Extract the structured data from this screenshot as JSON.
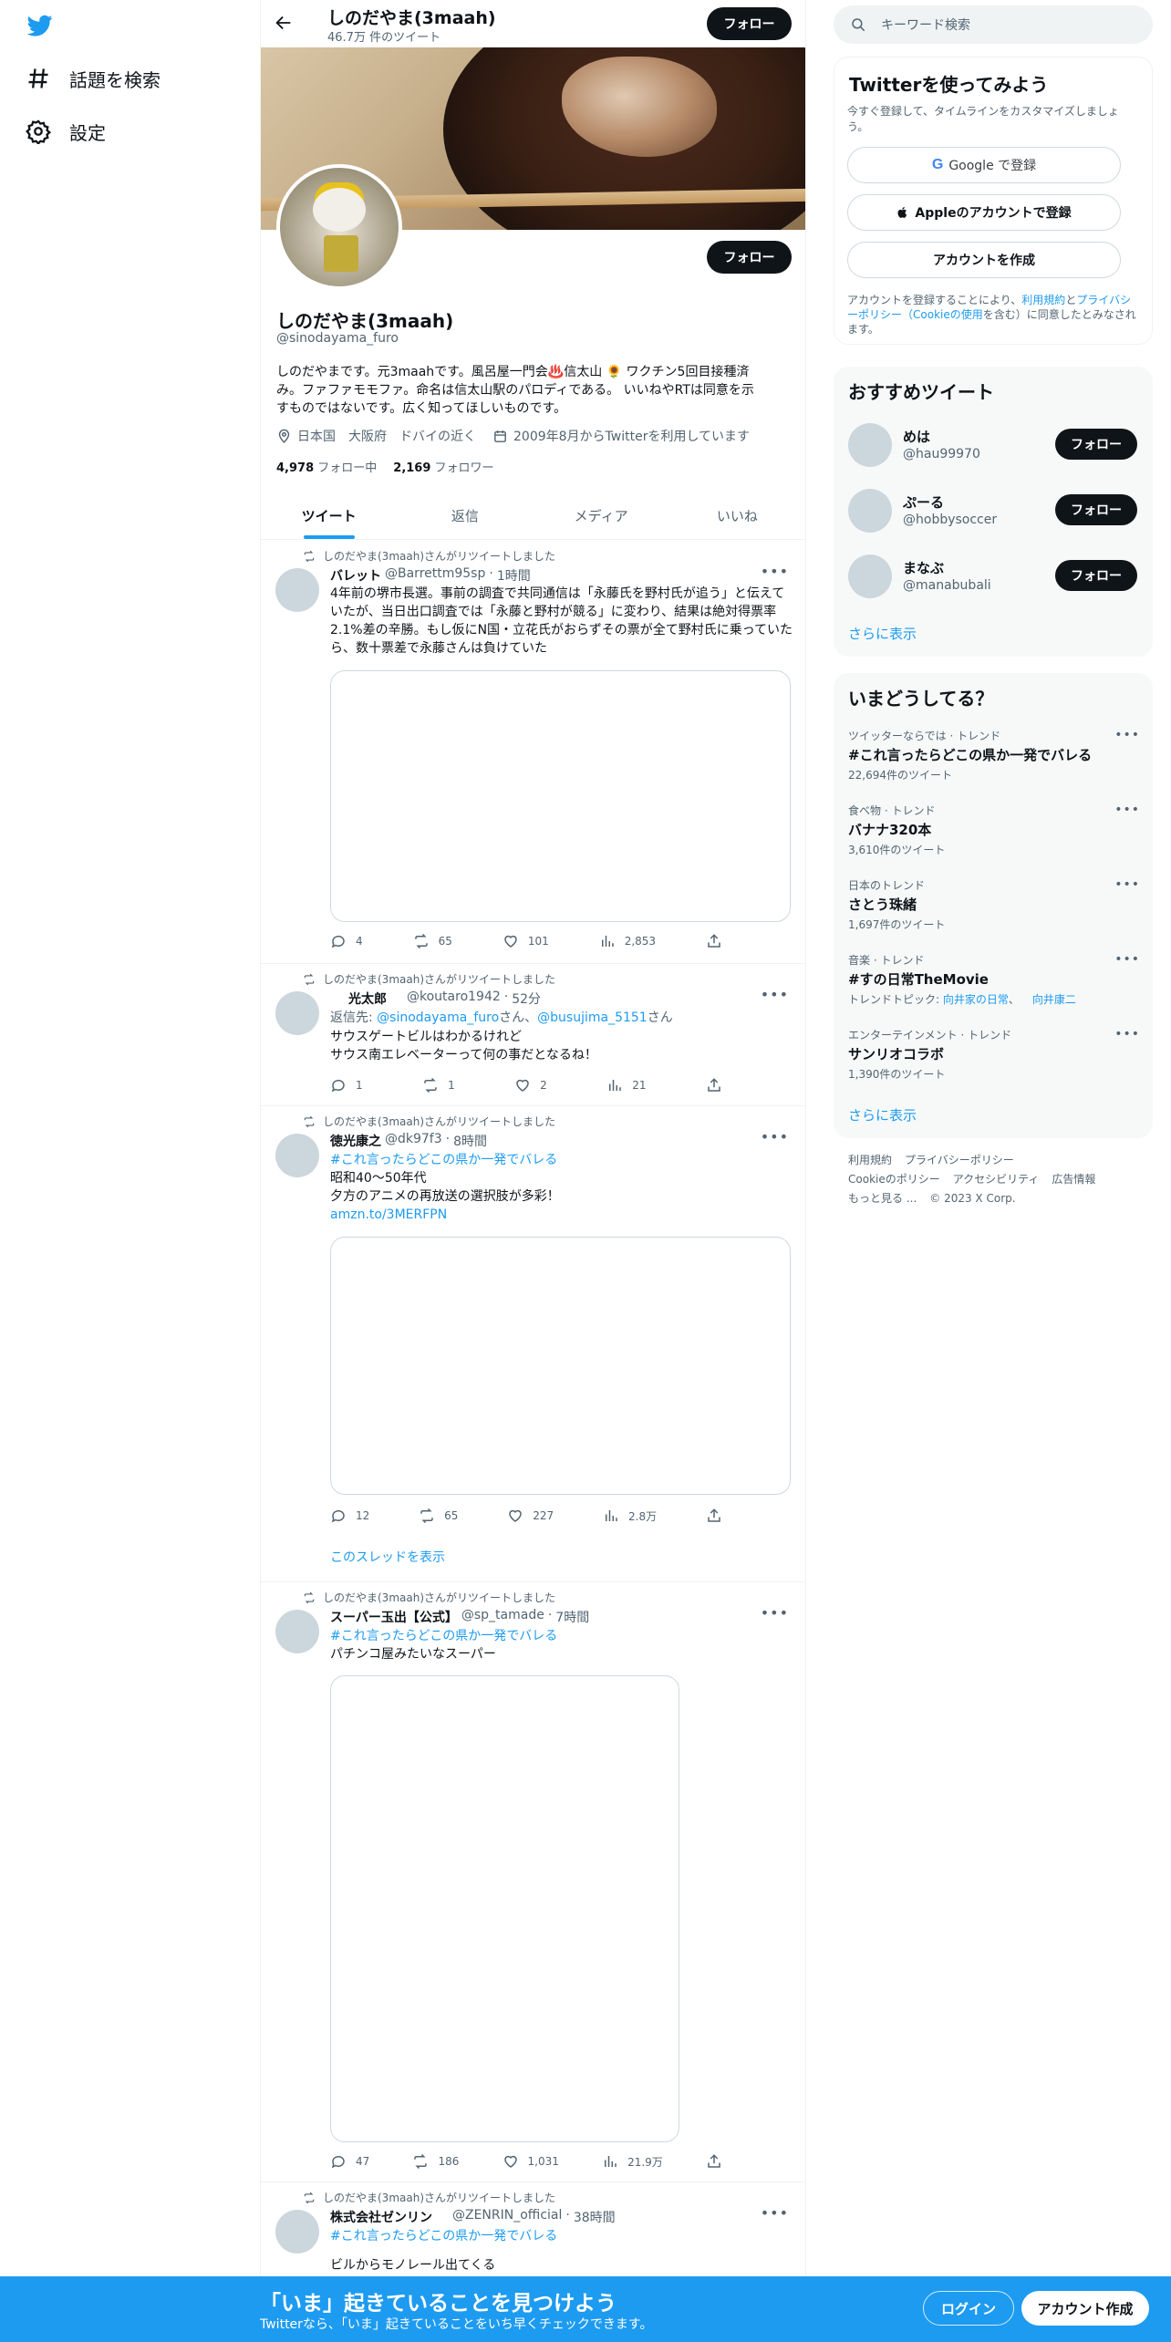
{
  "nav": {
    "explore_label": "話題を検索",
    "settings_label": "設定"
  },
  "header": {
    "name": "しのだやま(3maah)",
    "tweet_count": "46.7万 件のツイート",
    "follow_label": "フォロー"
  },
  "profile": {
    "follow_label": "フォロー",
    "name": "しのだやま(3maah)",
    "handle": "@sinodayama_furo",
    "bio_line1": "しのだやまです。元3maahです。風呂屋一門会♨️信太山 🌻 ワクチン5回目接種済",
    "bio_line2": "み。ファファモモファ。命名は信太山駅のパロディである。 いいねやRTは同意を示",
    "bio_line3": "すものではないです。広く知ってほしいものです。",
    "location": "日本国　大阪府　ドバイの近く",
    "joined": "2009年8月からTwitterを利用しています",
    "following_count": "4,978",
    "following_label": "フォロー中",
    "followers_count": "2,169",
    "followers_label": "フォロワー"
  },
  "tabs": [
    "ツイート",
    "返信",
    "メディア",
    "いいね"
  ],
  "tweets": [
    {
      "retweet_label": "しのだやま(3maah)さんがリツイートしました",
      "name": "バレット",
      "handle": "@Barrettm95sp",
      "time": "1時間",
      "text": "4年前の堺市長選。事前の調査で共同通信は「永藤氏を野村氏が追う」と伝えていたが、当日出口調査では「永藤と野村が競る」に変わり、結果は絶対得票率2.1%差の辛勝。もし仮にN国・立花氏がおらずその票が全て野村氏に乗っていたら、数十票差で永藤さんは負けていた",
      "replies": "4",
      "retweets": "65",
      "likes": "101",
      "views": "2,853"
    },
    {
      "retweet_label": "しのだやま(3maah)さんがリツイートしました",
      "name": "光太郎",
      "handle": "@koutaro1942",
      "time": "52分",
      "reply_prefix": "返信先: ",
      "reply_to_1": "@sinodayama_furo",
      "reply_mid": "さん、",
      "reply_to_2": "@busujima_5151",
      "reply_suffix": "さん",
      "text_line1": "サウスゲートビルはわかるけれど",
      "text_line2": "サウス南エレベーターって何の事だとなるね！",
      "replies": "1",
      "retweets": "1",
      "likes": "2",
      "views": "21"
    },
    {
      "retweet_label": "しのだやま(3maah)さんがリツイートしました",
      "name": "徳光康之",
      "handle": "@dk97f3",
      "time": "8時間",
      "hashtag": "#これ言ったらどこの県か一発でバレる",
      "text_line1": "昭和40〜50年代",
      "text_line2": "夕方のアニメの再放送の選択肢が多彩！",
      "link": "amzn.to/3MERFPN",
      "replies": "12",
      "retweets": "65",
      "likes": "227",
      "views": "2.8万",
      "show_thread": "このスレッドを表示"
    },
    {
      "retweet_label": "しのだやま(3maah)さんがリツイートしました",
      "name": "スーパー玉出【公式】",
      "handle": "@sp_tamade",
      "time": "7時間",
      "hashtag": "#これ言ったらどこの県か一発でバレる",
      "text": "パチンコ屋みたいなスーパー",
      "replies": "47",
      "retweets": "186",
      "likes": "1,031",
      "views": "21.9万"
    },
    {
      "retweet_label": "しのだやま(3maah)さんがリツイートしました",
      "name": "株式会社ゼンリン",
      "handle": "@ZENRIN_official",
      "time": "38時間",
      "hashtag": "#これ言ったらどこの県か一発でバレる",
      "text": "ビルからモノレール出てくる"
    }
  ],
  "right": {
    "search_placeholder": "キーワード検索",
    "signup": {
      "title": "Twitterを使ってみよう",
      "subtitle": "今すぐ登録して、タイムラインをカスタマイズしましょう。",
      "google": "Google で登録",
      "apple": "Appleのアカウントで登録",
      "create": "アカウントを作成",
      "terms_1": "アカウントを登録することにより、",
      "terms_link1": "利用規約",
      "terms_2": "と",
      "terms_link2": "プライバシーポリシー",
      "terms_link3": "（Cookieの使用",
      "terms_3": "を含む）に同意したとみなされます。"
    },
    "recommend": {
      "title": "おすすめツイート",
      "users": [
        {
          "name": "めは",
          "handle": "@hau99970"
        },
        {
          "name": "ぷーる",
          "handle": "@hobbysoccer"
        },
        {
          "name": "まなぶ",
          "handle": "@manabubali"
        }
      ],
      "follow_label": "フォロー",
      "show_more": "さらに表示"
    },
    "trends": {
      "title": "いまどうしてる？",
      "items": [
        {
          "context": "ツイッターならでは · トレンド",
          "name": "#これ言ったらどこの県か一発でバレる",
          "count": "22,694件のツイート"
        },
        {
          "context": "食べ物 · トレンド",
          "name": "バナナ320本",
          "count": "3,610件のツイート"
        },
        {
          "context": "日本のトレンド",
          "name": "さとう珠緒",
          "count": "1,697件のツイート"
        },
        {
          "context": "音楽 · トレンド",
          "name": "#すの日常TheMovie",
          "count_prefix": "トレンドトピック: ",
          "topic1": "向井家の日常",
          "topic_sep": "、",
          "topic2": "向井康二"
        },
        {
          "context": "エンターテインメント · トレンド",
          "name": "サンリオコラボ",
          "count": "1,390件のツイート"
        }
      ],
      "show_more": "さらに表示"
    },
    "footer": {
      "links": [
        "利用規約",
        "プライバシーポリシー",
        "Cookieのポリシー",
        "アクセシビリティ",
        "広告情報",
        "もっと見る ..."
      ],
      "copyright": "© 2023 X Corp."
    }
  },
  "bottom_bar": {
    "title": "「いま」起きていることを見つけよう",
    "subtitle": "Twitterなら、「いま」起きていることをいち早くチェックできます。",
    "login": "ログイン",
    "signup": "アカウント作成"
  },
  "colors": {
    "brand": "#1d9bf0",
    "text": "#0f1419",
    "secondary": "#536471"
  }
}
